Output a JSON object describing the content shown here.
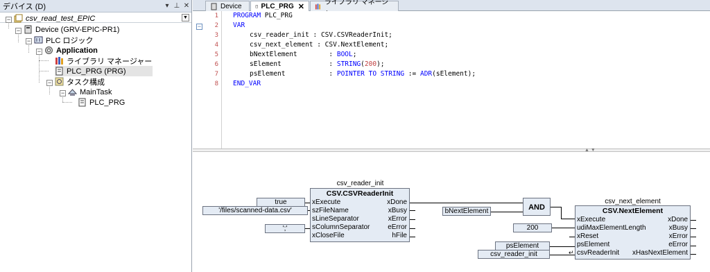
{
  "left_panel": {
    "title": "デバイス (D)",
    "buttons": {
      "dropdown": "▾",
      "pin": "⊥",
      "close": "✕"
    },
    "tree": [
      {
        "label": "csv_read_test_EPIC",
        "style": "italic"
      },
      {
        "label": "Device (GRV-EPIC-PR1)"
      },
      {
        "label": "PLC ロジック"
      },
      {
        "label": "Application",
        "style": "bold"
      },
      {
        "label": "ライブラリ マネージャー"
      },
      {
        "label": "PLC_PRG (PRG)",
        "selected": true
      },
      {
        "label": "タスク構成"
      },
      {
        "label": "MainTask"
      },
      {
        "label": "PLC_PRG"
      }
    ]
  },
  "tabs": [
    {
      "label": "Device"
    },
    {
      "label": "PLC_PRG",
      "active": true,
      "close": "✕"
    },
    {
      "label": "ライブラリ マネージャー"
    }
  ],
  "code": {
    "line_numbers": [
      "1",
      "2",
      "3",
      "4",
      "5",
      "6",
      "7",
      "8"
    ],
    "lines": {
      "l1_kw": "PROGRAM",
      "l1_rest": " PLC_PRG",
      "l2_kw": "VAR",
      "l3": "csv_reader_init : CSV.CSVReaderInit;",
      "l4": "csv_next_element : CSV.NextElement;",
      "l5_a": "bNextElement        : ",
      "l5_kw": "BOOL",
      "l5_b": ";",
      "l6_a": "sElement            : ",
      "l6_kw": "STRING",
      "l6_b": "(",
      "l6_num": "200",
      "l6_c": ");",
      "l7_a": "psElement           : ",
      "l7_kw": "POINTER TO STRING",
      "l7_b": " := ",
      "l7_kw2": "ADR",
      "l7_c": "(sElement);",
      "l8_kw": "END_VAR"
    },
    "fold_marker": "−"
  },
  "fbd": {
    "reader": {
      "instance": "csv_reader_init",
      "type": "CSV.CSVReaderInit",
      "inputs": [
        "xExecute",
        "szFileName",
        "sLineSeparator",
        "sColumnSeparator",
        "xCloseFile"
      ],
      "outputs": [
        "xDone",
        "xBusy",
        "xError",
        "eError",
        "hFile"
      ],
      "input_values": {
        "xExecute": "true",
        "szFileName": "'/files/scanned-data.csv'",
        "sColumnSeparator": "';'"
      }
    },
    "and_block": {
      "label": "AND",
      "input_var": "bNextElement"
    },
    "next": {
      "instance": "csv_next_element",
      "type": "CSV.NextElement",
      "inputs": [
        "xExecute",
        "udiMaxElementLength",
        "xReset",
        "psElement",
        "csvReaderInit"
      ],
      "outputs": [
        "xDone",
        "xBusy",
        "xError",
        "eError",
        "xHasNextElement"
      ],
      "input_values": {
        "udiMaxElementLength": "200",
        "psElement": "psElement",
        "csvReaderInit": "csv_reader_init"
      },
      "ref_arrow": "↵"
    }
  },
  "colors": {
    "keyword": "#0000ff",
    "block_fill": "#e4ebf4",
    "line_number": "#c05050"
  }
}
